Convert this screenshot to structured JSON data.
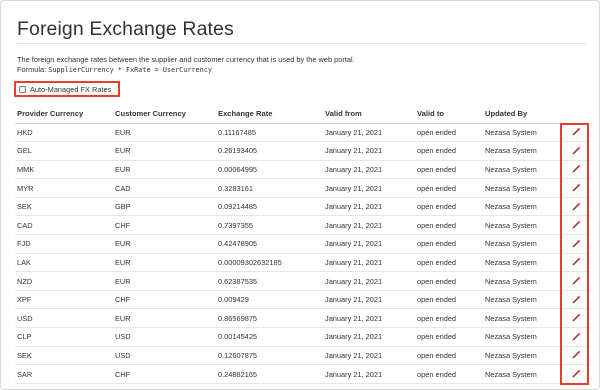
{
  "page": {
    "title": "Foreign Exchange Rates",
    "description": "The foreign exchange rates between the supplier and customer currency that is used by the web portal.",
    "formula_label": "Formula:",
    "formula_code": "SupplierCurrency * FxRate = UserCurrency"
  },
  "auto_managed": {
    "label": "Auto-Managed FX Rates",
    "checked": false
  },
  "table": {
    "headers": [
      "Provider Currency",
      "Customer Currency",
      "Exchange Rate",
      "Valid from",
      "Valid to",
      "Updated By"
    ],
    "rows": [
      {
        "provider": "HKD",
        "customer": "EUR",
        "rate": "0.11167485",
        "valid_from": "January 21, 2021",
        "valid_to": "open ended",
        "updated_by": "Nezasa System"
      },
      {
        "provider": "GEL",
        "customer": "EUR",
        "rate": "0.26193405",
        "valid_from": "January 21, 2021",
        "valid_to": "open ended",
        "updated_by": "Nezasa System"
      },
      {
        "provider": "MMK",
        "customer": "EUR",
        "rate": "0.00064995",
        "valid_from": "January 21, 2021",
        "valid_to": "open ended",
        "updated_by": "Nezasa System"
      },
      {
        "provider": "MYR",
        "customer": "CAD",
        "rate": "0.3283161",
        "valid_from": "January 21, 2021",
        "valid_to": "open ended",
        "updated_by": "Nezasa System"
      },
      {
        "provider": "SEK",
        "customer": "GBP",
        "rate": "0.09214485",
        "valid_from": "January 21, 2021",
        "valid_to": "open ended",
        "updated_by": "Nezasa System"
      },
      {
        "provider": "CAD",
        "customer": "CHF",
        "rate": "0.7397355",
        "valid_from": "January 21, 2021",
        "valid_to": "open ended",
        "updated_by": "Nezasa System"
      },
      {
        "provider": "FJD",
        "customer": "EUR",
        "rate": "0.42478905",
        "valid_from": "January 21, 2021",
        "valid_to": "open ended",
        "updated_by": "Nezasa System"
      },
      {
        "provider": "LAK",
        "customer": "EUR",
        "rate": "0.00009302632185",
        "valid_from": "January 21, 2021",
        "valid_to": "open ended",
        "updated_by": "Nezasa System"
      },
      {
        "provider": "NZD",
        "customer": "EUR",
        "rate": "0.62387535",
        "valid_from": "January 21, 2021",
        "valid_to": "open ended",
        "updated_by": "Nezasa System"
      },
      {
        "provider": "XPF",
        "customer": "CHF",
        "rate": "0.009429",
        "valid_from": "January 21, 2021",
        "valid_to": "open ended",
        "updated_by": "Nezasa System"
      },
      {
        "provider": "USD",
        "customer": "EUR",
        "rate": "0.86569875",
        "valid_from": "January 21, 2021",
        "valid_to": "open ended",
        "updated_by": "Nezasa System"
      },
      {
        "provider": "CLP",
        "customer": "USD",
        "rate": "0.00145425",
        "valid_from": "January 21, 2021",
        "valid_to": "open ended",
        "updated_by": "Nezasa System"
      },
      {
        "provider": "SEK",
        "customer": "USD",
        "rate": "0.12607875",
        "valid_from": "January 21, 2021",
        "valid_to": "open ended",
        "updated_by": "Nezasa System"
      },
      {
        "provider": "SAR",
        "customer": "CHF",
        "rate": "0.24882165",
        "valid_from": "January 21, 2021",
        "valid_to": "open ended",
        "updated_by": "Nezasa System"
      }
    ]
  },
  "icons": {
    "edit": "pencil-icon"
  },
  "colors": {
    "highlight": "#e2402c",
    "pencil_body": "#c0392b",
    "pencil_tip": "#2b2b2b"
  }
}
